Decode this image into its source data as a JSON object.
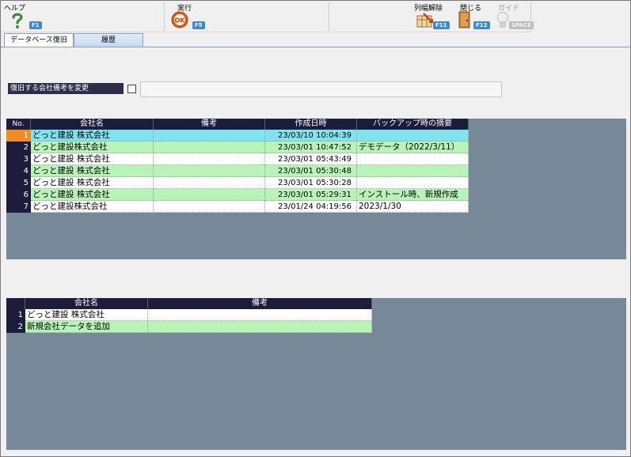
{
  "toolbar": {
    "help": {
      "label": "ヘルプ",
      "key": "F1",
      "icon": "help-question-icon"
    },
    "run": {
      "label": "実行",
      "key": "F5",
      "icon": "ok-icon"
    },
    "reset_width": {
      "label": "列幅解除",
      "key": "F11",
      "icon": "column-width-icon"
    },
    "close": {
      "label": "閉じる",
      "key": "F12",
      "icon": "door-close-icon"
    },
    "guide": {
      "label": "ガイド",
      "key": "SPACE",
      "icon": "lightbulb-icon"
    }
  },
  "tabs": [
    {
      "label": "データベース復旧",
      "active": true
    },
    {
      "label": "履歴",
      "active": false
    }
  ],
  "option": {
    "label": "復旧する会社備考を変更",
    "checked": false,
    "value": ""
  },
  "backup_table": {
    "headers": [
      "No.",
      "会社名",
      "備考",
      "作成日時",
      "バックアップ時の摘要"
    ],
    "rows": [
      {
        "no": "1",
        "company": "どっと建設 株式会社",
        "note": "",
        "created": "23/03/10 10:04:39",
        "summary": "",
        "selected": true
      },
      {
        "no": "2",
        "company": "どっと建設株式会社",
        "note": "",
        "created": "23/03/01 10:47:52",
        "summary": "デモデータ（2022/3/11）"
      },
      {
        "no": "3",
        "company": "どっと建設 株式会社",
        "note": "",
        "created": "23/03/01 05:43:49",
        "summary": ""
      },
      {
        "no": "4",
        "company": "どっと建設 株式会社",
        "note": "",
        "created": "23/03/01 05:30:48",
        "summary": ""
      },
      {
        "no": "5",
        "company": "どっと建設 株式会社",
        "note": "",
        "created": "23/03/01 05:30:28",
        "summary": ""
      },
      {
        "no": "6",
        "company": "どっと建設 株式会社",
        "note": "",
        "created": "23/03/01 05:29:31",
        "summary": "インストール時、新規作成"
      },
      {
        "no": "7",
        "company": "どっと建設株式会社",
        "note": "",
        "created": "23/01/24 04:19:56",
        "summary": "2023/1/30"
      }
    ]
  },
  "target_table": {
    "headers": [
      "",
      "会社名",
      "備考"
    ],
    "rows": [
      {
        "no": "1",
        "company": "どっと建設 株式会社",
        "note": ""
      },
      {
        "no": "2",
        "company": "新規会社データを追加",
        "note": ""
      }
    ]
  },
  "colors": {
    "header_bg": "#1c1c3c",
    "row_selected": "#7fe4ef",
    "row_green": "#b8f3b8",
    "row_white": "#ffffff",
    "grid_bg": "#778899",
    "selected_marker": "#f08c28",
    "fkey_bg": "#3a8ad8"
  }
}
